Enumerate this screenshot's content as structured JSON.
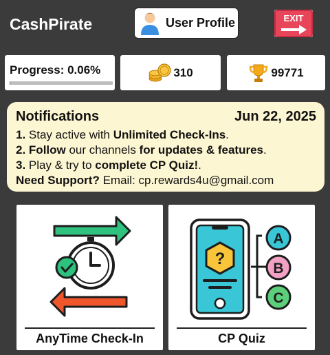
{
  "app": {
    "title": "CashPirate"
  },
  "header": {
    "profile_label": "User Profile",
    "exit_label": "EXIT"
  },
  "stats": {
    "progress_label": "Progress: 0.06%",
    "progress_fraction": 0.0006,
    "coins": "310",
    "coins_icon": "gold-coins-icon",
    "trophies": "99771",
    "trophy_icon": "trophy-icon"
  },
  "notifications": {
    "title": "Notifications",
    "date": "Jun 22, 2025",
    "items": [
      {
        "num": "1.",
        "pre": " Stay active with ",
        "bold": "Unlimited Check-Ins",
        "post": "."
      },
      {
        "num": "2.",
        "pre": " ",
        "bold1": "Follow",
        "mid": " our channels ",
        "bold2": "for updates & features",
        "post": "."
      },
      {
        "num": "3.",
        "pre": " Play & try to ",
        "bold": "complete CP Quiz!",
        "post": "."
      }
    ],
    "support_label": "Need Support?",
    "support_text": " Email: cp.rewards4u@gmail.com"
  },
  "tiles": [
    {
      "label": "AnyTime Check-In",
      "icon": "clock-exchange-icon"
    },
    {
      "label": "CP Quiz",
      "icon": "phone-quiz-icon"
    }
  ],
  "colors": {
    "background": "#3b3b3b",
    "notification_bg": "#fdf6d2",
    "exit_red": "#e8455b",
    "green_arrow": "#2ec27e",
    "orange_arrow": "#f0562b"
  }
}
